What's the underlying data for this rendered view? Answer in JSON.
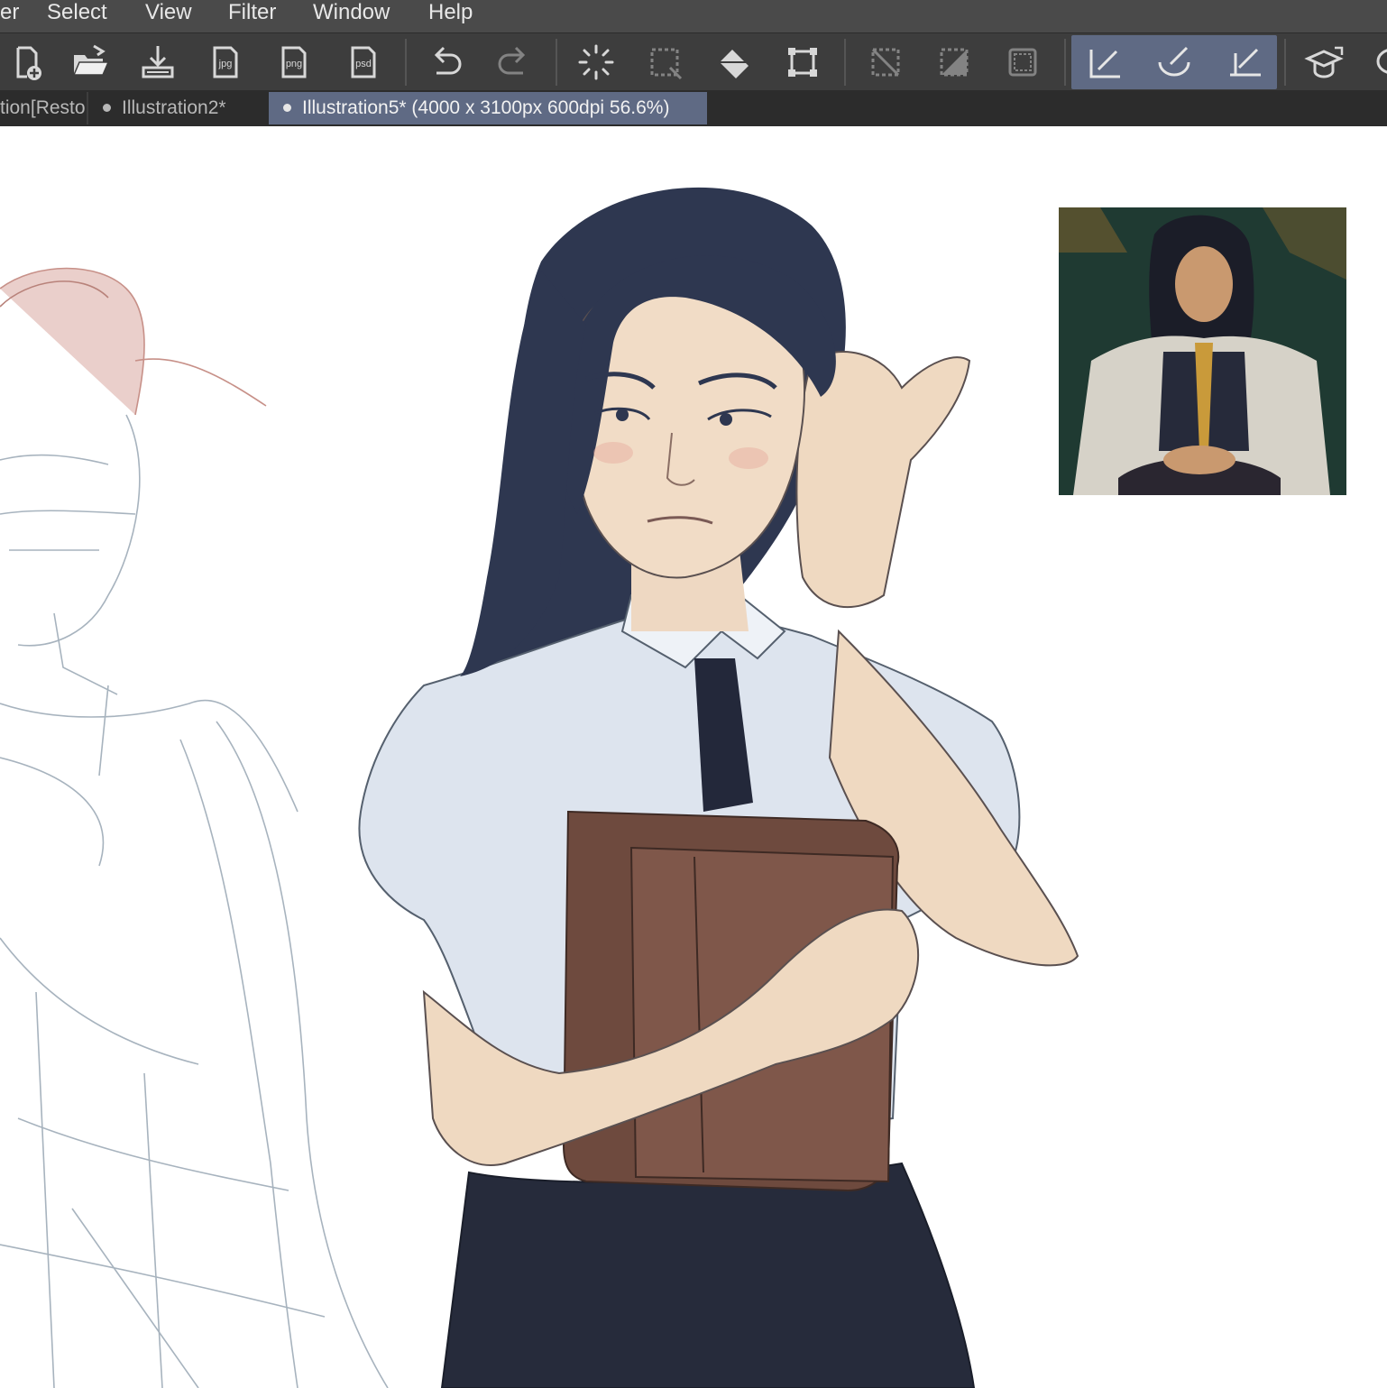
{
  "menu": {
    "items": [
      "er",
      "Select",
      "View",
      "Filter",
      "Window",
      "Help"
    ]
  },
  "toolbar": {
    "tools": [
      {
        "icon": "new-file-icon"
      },
      {
        "icon": "open-folder-icon"
      },
      {
        "icon": "save-download-icon"
      },
      {
        "icon": "export-jpg-icon",
        "label": "jpg"
      },
      {
        "icon": "export-png-icon",
        "label": "png"
      },
      {
        "icon": "export-psd-icon",
        "label": "psd"
      },
      {
        "icon": "undo-icon"
      },
      {
        "icon": "redo-icon"
      },
      {
        "icon": "loading-spinner-icon"
      },
      {
        "icon": "selection-marquee-icon"
      },
      {
        "icon": "fill-bucket-icon"
      },
      {
        "icon": "transform-icon"
      },
      {
        "icon": "clear-selection-icon"
      },
      {
        "icon": "invert-selection-icon"
      },
      {
        "icon": "show-selection-icon"
      },
      {
        "icon": "ruler-pen-icon"
      },
      {
        "icon": "curve-ruler-icon"
      },
      {
        "icon": "ruler-angle-icon"
      },
      {
        "icon": "learn-cap-icon"
      },
      {
        "icon": "chat-icon"
      }
    ]
  },
  "tabs": [
    {
      "label": "tion[Resto",
      "active": false
    },
    {
      "label": "Illustration2*",
      "active": false
    },
    {
      "label": "Illustration5* (4000 x 3100px 600dpi 56.6%)",
      "active": true
    }
  ],
  "colors": {
    "menubar": "#4a4a4a",
    "toolbar": "#3d3d3d",
    "tabbar": "#2c2c2c",
    "accent": "#5f6a84",
    "canvas": "#ffffff"
  }
}
